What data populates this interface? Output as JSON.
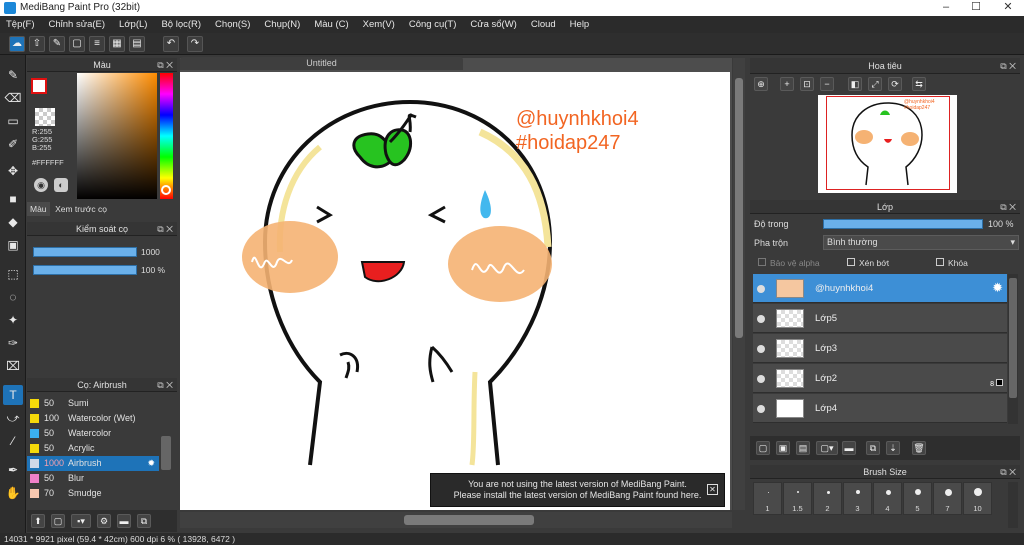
{
  "window": {
    "title": "MediBang Paint Pro (32bit)",
    "min": "–",
    "max": "☐",
    "close": "✕"
  },
  "menu": [
    "Tệp(F)",
    "Chỉnh sửa(E)",
    "Lớp(L)",
    "Bộ lọc(R)",
    "Chọn(S)",
    "Chụp(N)",
    "Màu (C)",
    "Xem(V)",
    "Công cụ(T)",
    "Cửa sổ(W)",
    "Cloud",
    "Help"
  ],
  "color_panel": {
    "title": "Màu",
    "rgb": {
      "r": "R:255",
      "g": "G:255",
      "b": "B:255"
    },
    "hex": "#FFFFFF",
    "tabs": [
      "Màu",
      "Xem trước cọ"
    ]
  },
  "brush_control": {
    "title": "Kiểm soát cọ",
    "size": "1000",
    "opacity": "100 %",
    "size_level": 1.0,
    "opacity_level": 1.0
  },
  "brush_list": {
    "title": "Cọ: Airbrush",
    "items": [
      {
        "size": "50",
        "name": "Sumi",
        "color": "#f5d90a"
      },
      {
        "size": "100",
        "name": "Watercolor (Wet)",
        "color": "#f5d90a"
      },
      {
        "size": "50",
        "name": "Watercolor",
        "color": "#3ab0f0"
      },
      {
        "size": "50",
        "name": "Acrylic",
        "color": "#f5d90a"
      },
      {
        "size": "1000",
        "name": "Airbrush",
        "color": "#cfd8e8",
        "selected": true
      },
      {
        "size": "50",
        "name": "Blur",
        "color": "#f080c8"
      },
      {
        "size": "70",
        "name": "Smudge",
        "color": "#f8c8b0"
      }
    ]
  },
  "document": {
    "tab": "Untitled",
    "watermark_1": "@huynhkhoi4",
    "watermark_2": "#hoidap247",
    "accent_color": "#f26522"
  },
  "notice": {
    "line1": "You are not using the latest version of MediBang Paint.",
    "line2": "Please install the latest version of MediBang Paint found here.",
    "close": "✕"
  },
  "navigator": {
    "title": "Hoa tiêu"
  },
  "layers": {
    "title": "Lớp",
    "opacity_label": "Độ trong",
    "opacity_value": "100 %",
    "opacity_level": 1.0,
    "blend_label": "Pha trộn",
    "blend_value": "Bình thường",
    "opt_alpha": "Bảo vệ alpha",
    "opt_clip": "Xén bớt",
    "opt_lock": "Khóa",
    "items": [
      {
        "name": "@huynhkhoi4",
        "selected": true
      },
      {
        "name": "Lớp5"
      },
      {
        "name": "Lớp3"
      },
      {
        "name": "Lớp2",
        "badge": "8"
      },
      {
        "name": "Lớp4"
      }
    ]
  },
  "brush_size": {
    "title": "Brush Size",
    "labels": [
      "1",
      "1.5",
      "2",
      "3",
      "4",
      "5",
      "7",
      "10"
    ]
  },
  "status": "14031 * 9921 pixel   (59.4 * 42cm)   600 dpi   6 %   ( 13928, 6472 )"
}
